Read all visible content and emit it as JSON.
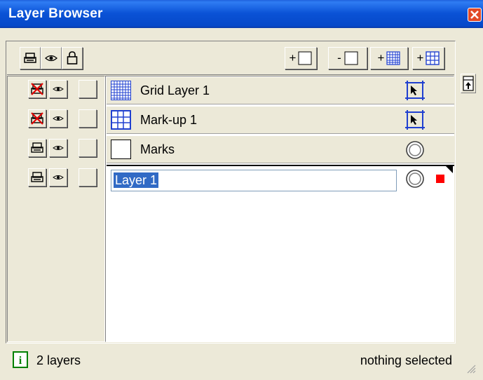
{
  "window": {
    "title": "Layer Browser"
  },
  "toolbar": {
    "left_icons": [
      "printer-icon",
      "eye-icon",
      "lock-icon"
    ],
    "right_buttons": [
      {
        "label": "+",
        "icon": "new-layer-icon"
      },
      {
        "label": "-",
        "icon": "delete-layer-icon"
      },
      {
        "label": "+",
        "icon": "new-grid-layer-icon"
      },
      {
        "label": "+",
        "icon": "new-markup-layer-icon"
      }
    ]
  },
  "layers": [
    {
      "name": "Grid Layer 1",
      "print": false,
      "visible": true,
      "locked": false,
      "thumb": "grid",
      "mode": "select-arrow"
    },
    {
      "name": "Mark-up 1",
      "print": false,
      "visible": true,
      "locked": false,
      "thumb": "markup",
      "mode": "select-arrow"
    },
    {
      "name": "Marks",
      "print": true,
      "visible": true,
      "locked": false,
      "thumb": "blank",
      "mode": "circle"
    },
    {
      "name": "Layer 1",
      "print": true,
      "visible": true,
      "locked": false,
      "thumb": "blank",
      "mode": "circle",
      "editing": true,
      "active_color": "#ff0000"
    }
  ],
  "status": {
    "count_text": "2 layers",
    "selection_text": "nothing selected"
  },
  "colors": {
    "title_bar": "#0a52d6",
    "selection": "#316ac5",
    "active_marker": "#ff0000"
  }
}
